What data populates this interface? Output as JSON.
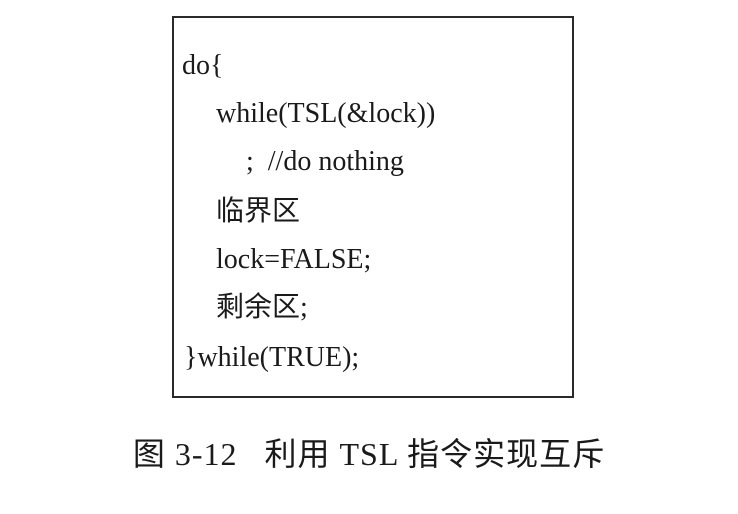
{
  "code": {
    "lines": [
      "do{",
      "while(TSL(&lock))",
      ";  //do nothing",
      "临界区",
      "lock=FALSE;",
      "剩余区;",
      "}while(TRUE);"
    ]
  },
  "caption": "图 3-12   利用 TSL 指令实现互斥"
}
